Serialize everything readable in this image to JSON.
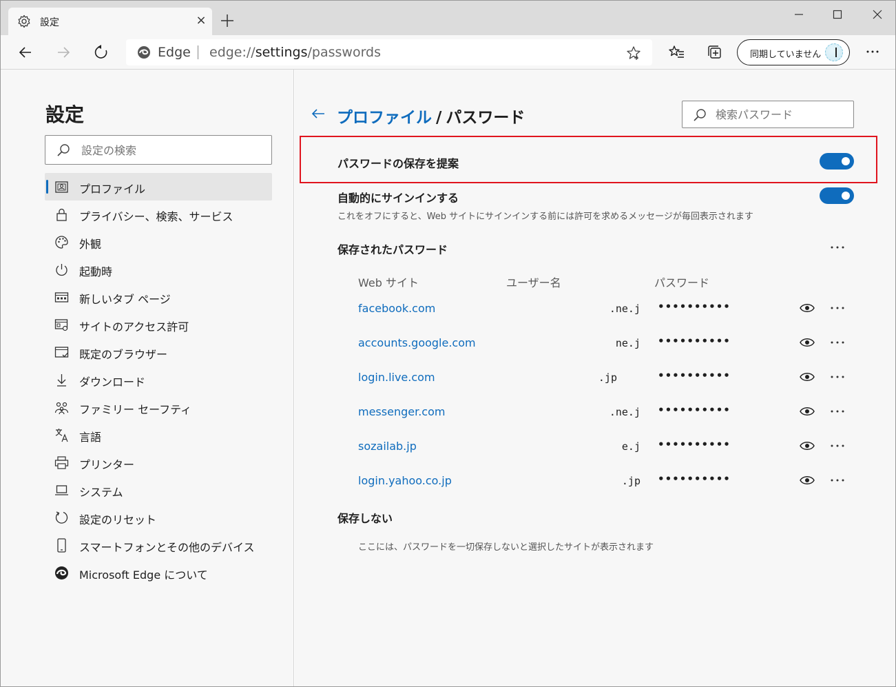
{
  "tab": {
    "title": "設定",
    "close": "×"
  },
  "address": {
    "edge_label": "Edge",
    "url_prefix": "edge://",
    "url_host": "settings",
    "url_path": "/passwords"
  },
  "toolbar": {
    "sync_label": "同期していません"
  },
  "sidebar": {
    "title": "設定",
    "search_placeholder": "設定の検索",
    "items": [
      {
        "label": "プロファイル",
        "icon": "profile-icon",
        "active": true
      },
      {
        "label": "プライバシー、検索、サービス",
        "icon": "lock-icon"
      },
      {
        "label": "外観",
        "icon": "palette-icon"
      },
      {
        "label": "起動時",
        "icon": "power-icon"
      },
      {
        "label": "新しいタブ ページ",
        "icon": "new-tab-page-icon"
      },
      {
        "label": "サイトのアクセス許可",
        "icon": "site-permissions-icon"
      },
      {
        "label": "既定のブラウザー",
        "icon": "default-browser-icon"
      },
      {
        "label": "ダウンロード",
        "icon": "download-icon"
      },
      {
        "label": "ファミリー セーフティ",
        "icon": "family-icon"
      },
      {
        "label": "言語",
        "icon": "language-icon"
      },
      {
        "label": "プリンター",
        "icon": "printer-icon"
      },
      {
        "label": "システム",
        "icon": "system-icon"
      },
      {
        "label": "設定のリセット",
        "icon": "reset-icon"
      },
      {
        "label": "スマートフォンとその他のデバイス",
        "icon": "phone-icon"
      },
      {
        "label": "Microsoft Edge について",
        "icon": "edge-icon"
      }
    ]
  },
  "main": {
    "breadcrumb_parent": "プロファイル",
    "breadcrumb_sep": "/",
    "breadcrumb_current": "パスワード",
    "search_placeholder": "検索パスワード",
    "offer_save": {
      "label": "パスワードの保存を提案",
      "enabled": true
    },
    "auto_signin": {
      "label": "自動的にサインインする",
      "description": "これをオフにすると、Web サイトにサインインする前には許可を求めるメッセージが毎回表示されます",
      "enabled": true
    },
    "saved_title": "保存されたパスワード",
    "columns": {
      "site": "Web サイト",
      "user": "ユーザー名",
      "password": "パスワード"
    },
    "passwords": [
      {
        "site": "facebook.com",
        "user": ".ne.j",
        "password": "••••••••••"
      },
      {
        "site": "accounts.google.com",
        "user": "ne.j",
        "password": "••••••••••"
      },
      {
        "site": "login.live.com",
        "user": ".jp",
        "password": "••••••••••"
      },
      {
        "site": "messenger.com",
        "user": ".ne.j",
        "password": "••••••••••"
      },
      {
        "site": "sozailab.jp",
        "user": "e.j",
        "password": "••••••••••"
      },
      {
        "site": "login.yahoo.co.jp",
        "user": ".jp",
        "password": "••••••••••"
      }
    ],
    "never_saved_title": "保存しない",
    "never_saved_desc": "ここには、パスワードを一切保存しないと選択したサイトが表示されます"
  },
  "colors": {
    "accent": "#0f6cbd",
    "highlight": "#e0141e"
  }
}
